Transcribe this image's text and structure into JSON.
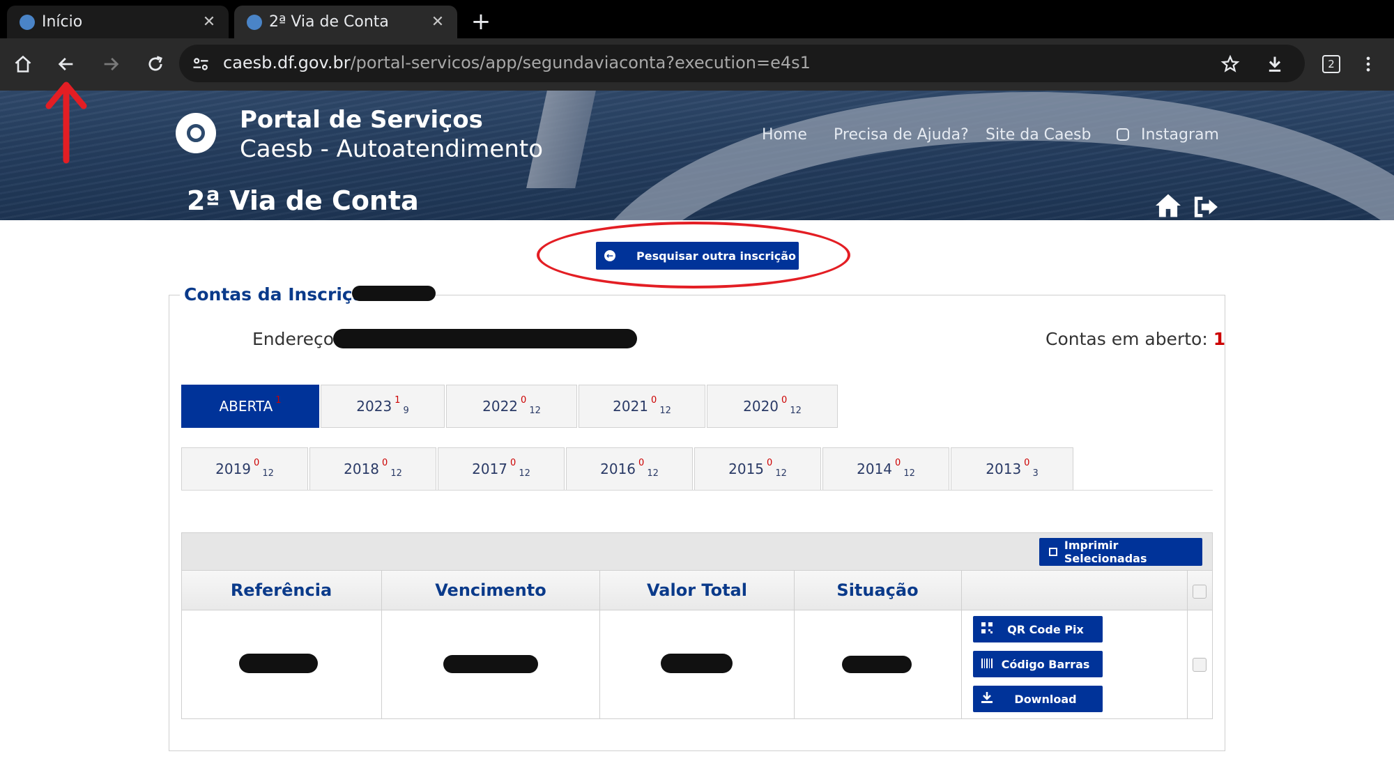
{
  "browser": {
    "tabs": [
      {
        "title": "Início",
        "close": "✕"
      },
      {
        "title": "2ª Via de Conta",
        "close": "✕"
      }
    ],
    "new_tab": "+",
    "url_host": "caesb.df.gov.br",
    "url_path": "/portal-servicos/app/segundaviaconta?execution=e4s1",
    "tab_count": "2"
  },
  "header": {
    "brand_title": "Portal de Serviços",
    "brand_subtitle": "Caesb - Autoatendimento",
    "nav": [
      "Home",
      "Precisa de Ajuda?",
      "Site da Caesb",
      "Instagram"
    ],
    "page_title": "2ª Via de Conta"
  },
  "search_again_label": "Pesquisar outra inscrição",
  "panel": {
    "legend": "Contas da Inscrição:",
    "address_label": "Endereço:",
    "open_accounts_label": "Contas em aberto:",
    "open_accounts_count": "1"
  },
  "year_tabs_row1": [
    {
      "label": "ABERTA",
      "sup": "1",
      "sub": ""
    },
    {
      "label": "2023",
      "sup": "1",
      "sub": "9"
    },
    {
      "label": "2022",
      "sup": "0",
      "sub": "12"
    },
    {
      "label": "2021",
      "sup": "0",
      "sub": "12"
    },
    {
      "label": "2020",
      "sup": "0",
      "sub": "12"
    }
  ],
  "year_tabs_row2": [
    {
      "label": "2019",
      "sup": "0",
      "sub": "12"
    },
    {
      "label": "2018",
      "sup": "0",
      "sub": "12"
    },
    {
      "label": "2017",
      "sup": "0",
      "sub": "12"
    },
    {
      "label": "2016",
      "sup": "0",
      "sub": "12"
    },
    {
      "label": "2015",
      "sup": "0",
      "sub": "12"
    },
    {
      "label": "2014",
      "sup": "0",
      "sub": "12"
    },
    {
      "label": "2013",
      "sup": "0",
      "sub": "3"
    }
  ],
  "table": {
    "print_selected_label": "Imprimir Selecionadas",
    "columns": [
      "Referência",
      "Vencimento",
      "Valor Total",
      "Situação"
    ],
    "actions": [
      "QR Code Pix",
      "Código Barras",
      "Download"
    ]
  },
  "colors": {
    "primary_blue": "#003399",
    "heading_blue": "#0a3a8a",
    "annotation_red": "#e31e24"
  }
}
